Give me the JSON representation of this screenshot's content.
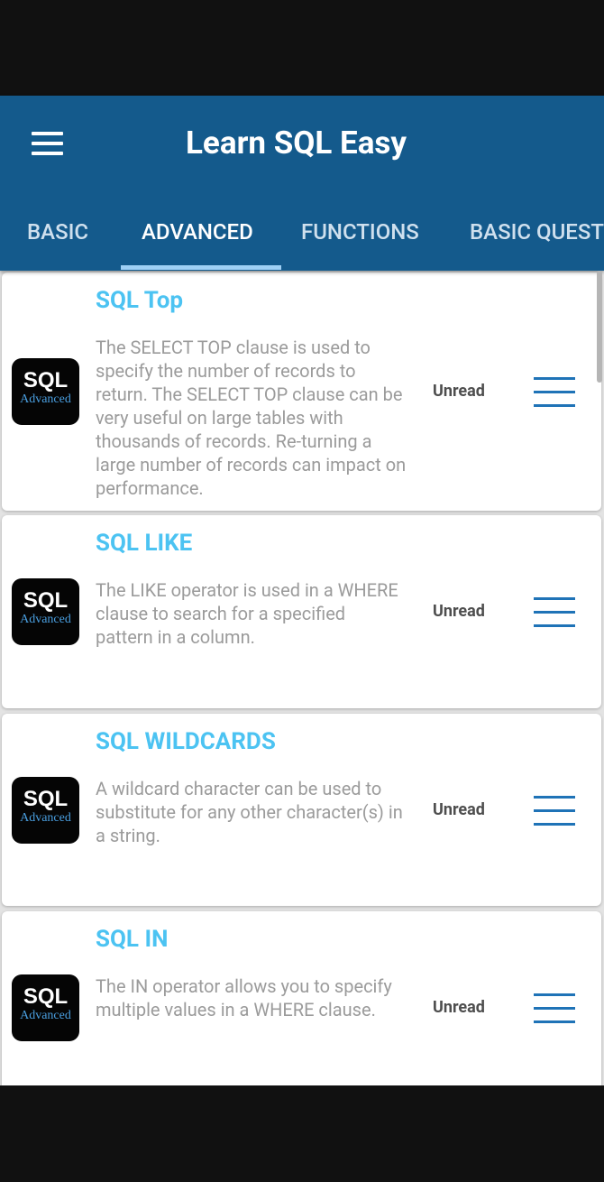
{
  "app": {
    "title": "Learn SQL Easy"
  },
  "tabs": [
    {
      "label": "BASIC"
    },
    {
      "label": "ADVANCED"
    },
    {
      "label": "FUNCTIONS"
    },
    {
      "label": "BASIC QUESTIONS"
    }
  ],
  "active_tab": "ADVANCED",
  "lessons": [
    {
      "title": "SQL Top",
      "description": "The SELECT TOP clause is used to specify the number of records to return. The SELECT TOP clause can be very useful on large tables with thousands of records. Re-turning a large number of records can impact on performance.",
      "status": "Unread",
      "logo_text": "SQL",
      "logo_subtext": "Advanced"
    },
    {
      "title": "SQL LIKE",
      "description": "The LIKE operator is used in a WHERE clause to search for a specified pattern in a column.",
      "status": "Unread",
      "logo_text": "SQL",
      "logo_subtext": "Advanced"
    },
    {
      "title": "SQL WILDCARDS",
      "description": "A wildcard character can be used to substitute for any other character(s) in a string.",
      "status": "Unread",
      "logo_text": "SQL",
      "logo_subtext": "Advanced"
    },
    {
      "title": "SQL IN",
      "description": "The IN operator allows you to specify multiple values in a WHERE clause.",
      "status": "Unread",
      "logo_text": "SQL",
      "logo_subtext": "Advanced"
    }
  ],
  "icons": {
    "nav": "hamburger-menu-icon",
    "item_menu": "hamburger-menu-icon"
  },
  "colors": {
    "app_bar": "#145a8c",
    "title_accent": "#4cc3f2",
    "tab_indicator": "#9fd0f5",
    "menu_icon": "#1f73b7"
  }
}
